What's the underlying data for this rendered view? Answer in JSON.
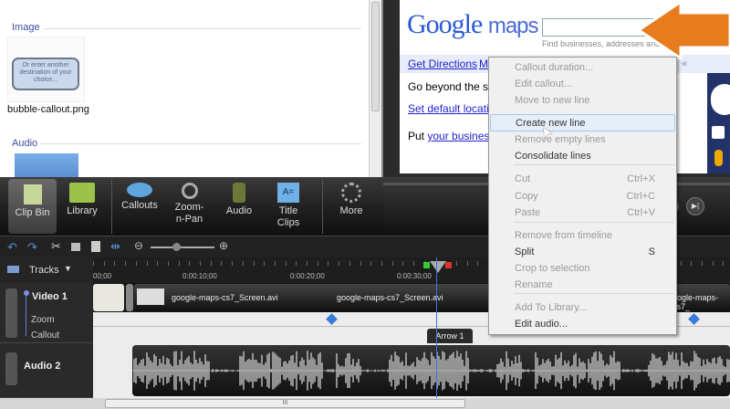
{
  "clip_bin": {
    "sections": [
      {
        "label": "Image"
      },
      {
        "label": "Audio"
      }
    ],
    "image_item": {
      "filename": "bubble-callout.png",
      "bubble_text": "Or enter another destination of your choice..."
    }
  },
  "preview": {
    "logo_google": "Google",
    "logo_maps": "maps",
    "search_hint": "Find businesses, addresses and",
    "links": [
      "Get Directions",
      "M"
    ],
    "body_text": "Go beyond the str",
    "set_default": "Set default locatio",
    "put_text": "Put ",
    "your_business": "your business",
    "collapse": "«"
  },
  "toolbar": {
    "items": [
      {
        "label": "Clip Bin",
        "icon": "clip-bin-icon"
      },
      {
        "label": "Library",
        "icon": "folder-icon"
      },
      {
        "label": "Callouts",
        "icon": "callout-icon"
      },
      {
        "label": "Zoom-n-Pan",
        "icon": "magnifier-icon"
      },
      {
        "label": "Audio",
        "icon": "speaker-icon"
      },
      {
        "label": "Title Clips",
        "icon": "title-clip-icon"
      },
      {
        "label": "More",
        "icon": "more-icon"
      }
    ]
  },
  "timeline": {
    "tracks_label": "Tracks",
    "ruler": [
      "00;00",
      "0:00:10;00",
      "0:00:20;00",
      "0:00:30;00"
    ],
    "video_track": "Video 1",
    "zoom_row": "Zoom",
    "callout_row": "Callout",
    "audio_track": "Audio 2",
    "clip_names": [
      "google-maps-cs7_Screen.avi",
      "google-maps-cs7_Screen.avi",
      "oogle-maps-cs7_"
    ],
    "callout_clip": "Arrow 1",
    "scroll_grip": "III"
  },
  "context_menu": {
    "items": [
      {
        "label": "Callout duration...",
        "enabled": false
      },
      {
        "label": "Edit callout...",
        "enabled": false
      },
      {
        "label": "Move to new line",
        "enabled": false
      },
      {
        "label": "Create new line",
        "enabled": true,
        "highlighted": true
      },
      {
        "label": "Remove empty lines",
        "enabled": false
      },
      {
        "label": "Consolidate lines",
        "enabled": true
      },
      {
        "label": "Cut",
        "shortcut": "Ctrl+X",
        "enabled": false
      },
      {
        "label": "Copy",
        "shortcut": "Ctrl+C",
        "enabled": false
      },
      {
        "label": "Paste",
        "shortcut": "Ctrl+V",
        "enabled": false
      },
      {
        "label": "Remove from timeline",
        "enabled": false
      },
      {
        "label": "Split",
        "shortcut": "S",
        "enabled": true
      },
      {
        "label": "Crop to selection",
        "enabled": false
      },
      {
        "label": "Rename",
        "enabled": false
      },
      {
        "label": "Add To Library...",
        "enabled": false
      },
      {
        "label": "Edit audio...",
        "enabled": true
      }
    ]
  },
  "colors": {
    "accent": "#3b6fd0",
    "arrow": "#e87b1e",
    "playhead": "#3a7ad8"
  }
}
